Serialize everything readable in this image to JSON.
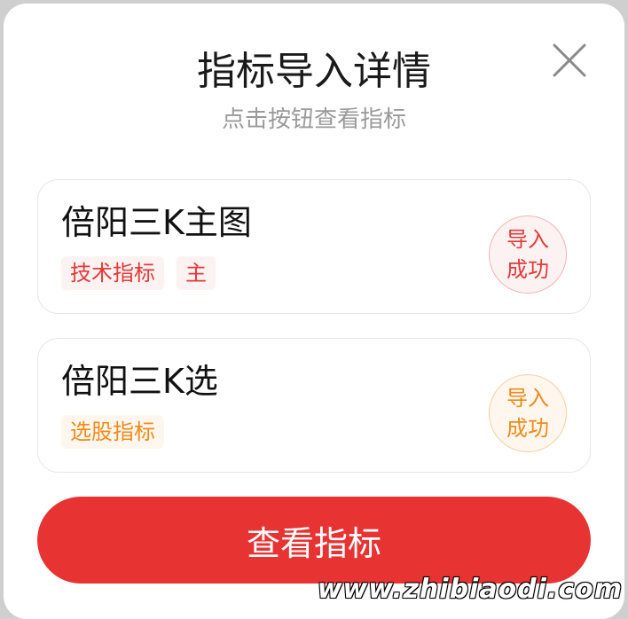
{
  "dialog": {
    "title": "指标导入详情",
    "subtitle": "点击按钮查看指标",
    "close_icon": "close-icon"
  },
  "items": [
    {
      "name": "倍阳三K主图",
      "tags": [
        "技术指标",
        "主"
      ],
      "status": [
        "导入",
        "成功"
      ],
      "accent": "#e23a3a"
    },
    {
      "name": "倍阳三K选",
      "tags": [
        "选股指标"
      ],
      "status": [
        "导入",
        "成功"
      ],
      "accent": "#f08a1c"
    }
  ],
  "primary_button": {
    "label": "查看指标",
    "color": "#e83333"
  },
  "watermark": "www.zhibiaodi.com"
}
